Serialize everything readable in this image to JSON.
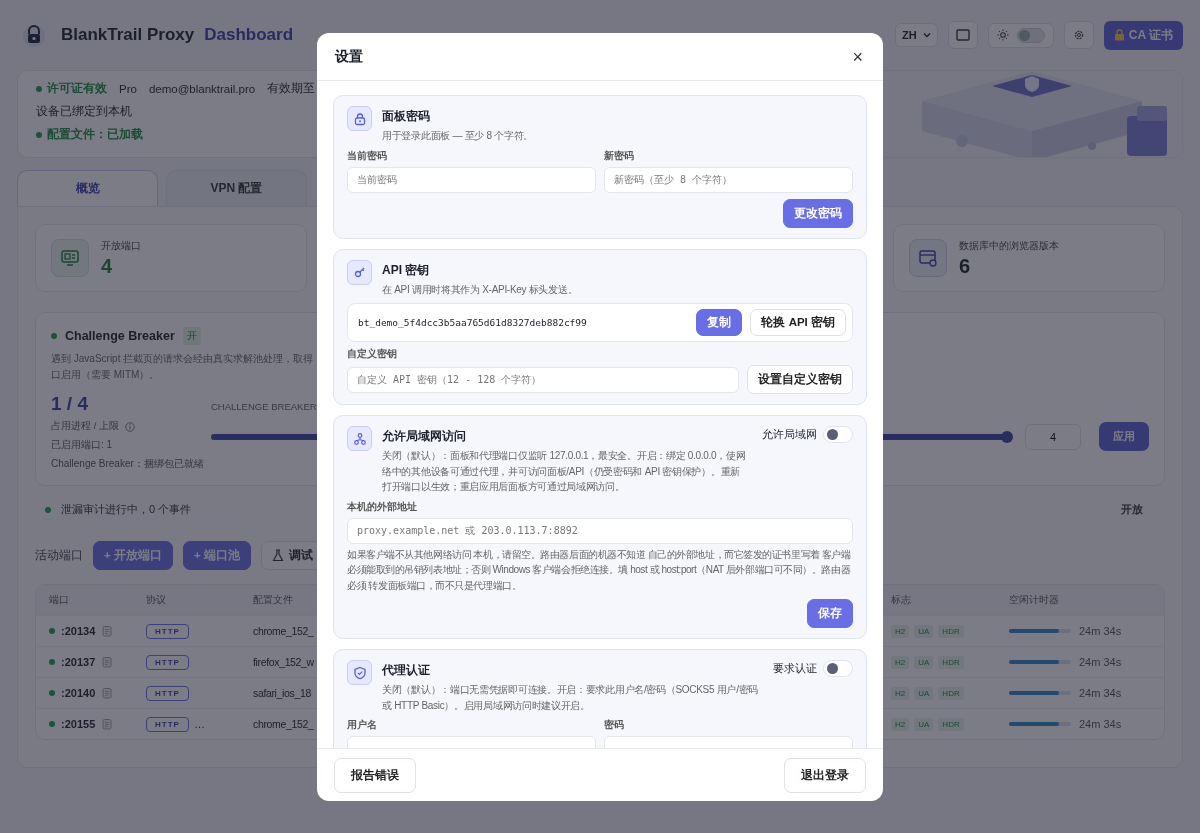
{
  "header": {
    "brand": "BlankTrail Proxy",
    "subtitle": "Dashboard",
    "language": "ZH",
    "theme_toggle": {
      "on": false
    },
    "ca_button": "CA 证书"
  },
  "license": {
    "status": "许可证有效",
    "plan": "Pro",
    "email": "demo@blanktrail.pro",
    "expiry": "有效期至",
    "device": "设备已绑定到本机",
    "config": "配置文件：已加载"
  },
  "tabs": [
    {
      "label": "概览",
      "selected": true
    },
    {
      "label": "VPN 配置",
      "selected": false
    }
  ],
  "stat_cards": [
    {
      "kind": "ports",
      "label": "开放端口",
      "value": "4"
    },
    {
      "kind": "browsers",
      "label": "数据库中的浏览器版本",
      "value": "6"
    }
  ],
  "challenge_breaker": {
    "title": "Challenge Breaker",
    "on": true,
    "badge": "开",
    "description_lines": [
      "遇到 JavaScript 拦截页的请求会经由真实求解池处理，取得",
      "口启用（需要 MITM）。"
    ],
    "usage": "1 / 4",
    "usage_label": "占用进程 / 上限",
    "enabled_ports": "已启用端口: 1",
    "bundle": "Challenge Breaker：捆绑包已就绪",
    "slider_label": "CHALLENGE BREAKER",
    "level": 1,
    "limit_value": "4",
    "apply": "应用"
  },
  "leak_audit": {
    "active": true,
    "text": "泄漏审计进行中，0 个事件",
    "status": "开放"
  },
  "active_ports": {
    "title": "活动端口",
    "buttons": [
      {
        "kind": "primary",
        "label": "+ 开放端口"
      },
      {
        "kind": "primary",
        "label": "+ 端口池"
      },
      {
        "kind": "outline",
        "label": "调试"
      }
    ],
    "columns": [
      "端口",
      "协议",
      "配置文件",
      "标志",
      "空闲计时器"
    ],
    "rows": [
      {
        "port": ":20134",
        "active": true,
        "protocol": "HTTP",
        "profile": "chrome_152_",
        "flags": [
          "H2",
          "UA",
          "HDR"
        ],
        "level": 0.8,
        "idle": "24m 34s"
      },
      {
        "port": ":20137",
        "active": true,
        "protocol": "HTTP",
        "profile": "firefox_152_w",
        "flags": [
          "H2",
          "UA",
          "HDR"
        ],
        "level": 0.8,
        "idle": "24m 34s"
      },
      {
        "port": ":20140",
        "active": true,
        "protocol": "HTTP",
        "profile": "safari_ios_18",
        "flags": [
          "H2",
          "UA",
          "HDR"
        ],
        "level": 0.8,
        "idle": "24m 34s"
      },
      {
        "port": ":20155",
        "active": true,
        "protocol": "HTTP",
        "protocol_extra": "…",
        "profile": "chrome_152_",
        "flags": [
          "H2",
          "UA",
          "HDR"
        ],
        "level": 0.8,
        "idle": "24m 34s"
      }
    ]
  },
  "modal": {
    "title": "设置",
    "close": "×",
    "sections": [
      {
        "kind": "password",
        "title": "面板密码",
        "description": "用于登录此面板 — 至少 8 个字符。",
        "rows": [
          {
            "kind": "fields",
            "fields": [
              {
                "label": "当前密码",
                "placeholder": "当前密码"
              },
              {
                "label": "新密码",
                "placeholder": "新密码（至少 8 个字符）"
              }
            ]
          },
          {
            "kind": "actions",
            "buttons": [
              {
                "kind": "primary",
                "label": "更改密码"
              }
            ]
          }
        ]
      },
      {
        "kind": "api_key",
        "title": "API 密钥",
        "description": "在 API 调用时将其作为 X-API-Key 标头发送。",
        "rows": [
          {
            "kind": "key_display",
            "value": "bt_demo_5f4dcc3b5aa765d61d8327deb882cf99",
            "buttons": [
              {
                "kind": "primary",
                "label": "复制"
              },
              {
                "kind": "outline",
                "label": "轮换 API 密钥"
              }
            ]
          },
          {
            "kind": "field_with_button",
            "label": "自定义密钥",
            "placeholder": "自定义 API 密钥（12 - 128 个字符）",
            "button": {
              "kind": "outline",
              "label": "设置自定义密钥"
            }
          }
        ]
      },
      {
        "kind": "lan",
        "title": "允许局域网访问",
        "description": "关闭（默认）：面板和代理端口仅监听 127.0.0.1，最安全。开启：绑定 0.0.0.0，使网络中的其他设备可通过代理，并可访问面板/API（仍受密码和 API 密钥保护）。重新打开端口以生效；重启应用后面板方可通过局域网访问。",
        "toggle": {
          "label": "允许局域网",
          "on": false
        },
        "rows": [
          {
            "kind": "field_wide",
            "label": "本机的外部地址",
            "placeholder": "proxy.example.net 或 203.0.113.7:8892",
            "help": "如果客户端不从其他网络访问 本机，请留空。路由器后面的机器不知道 自己的外部地址，而它签发的证书里写着 客户端必须能取到的吊销列表地址；否则 Windows 客户端会拒绝连接。填 host 或 host:port（NAT 后外部端口可不同）。路由器必须 转发面板端口，而不只是代理端口。"
          },
          {
            "kind": "actions",
            "buttons": [
              {
                "kind": "primary",
                "label": "保存"
              }
            ]
          }
        ]
      },
      {
        "kind": "auth",
        "title": "代理认证",
        "description": "关闭（默认）：端口无需凭据即可连接。开启：要求此用户名/密码（SOCKS5 用户/密码或 HTTP Basic）。启用局域网访问时建议开启。",
        "toggle": {
          "label": "要求认证",
          "on": false
        },
        "rows": [
          {
            "kind": "fields",
            "fields": [
              {
                "label": "用户名"
              },
              {
                "label": "密码"
              }
            ]
          }
        ]
      }
    ],
    "footer": [
      {
        "kind": "outline",
        "label": "报告错误"
      },
      {
        "kind": "outline",
        "label": "退出登录"
      }
    ]
  }
}
